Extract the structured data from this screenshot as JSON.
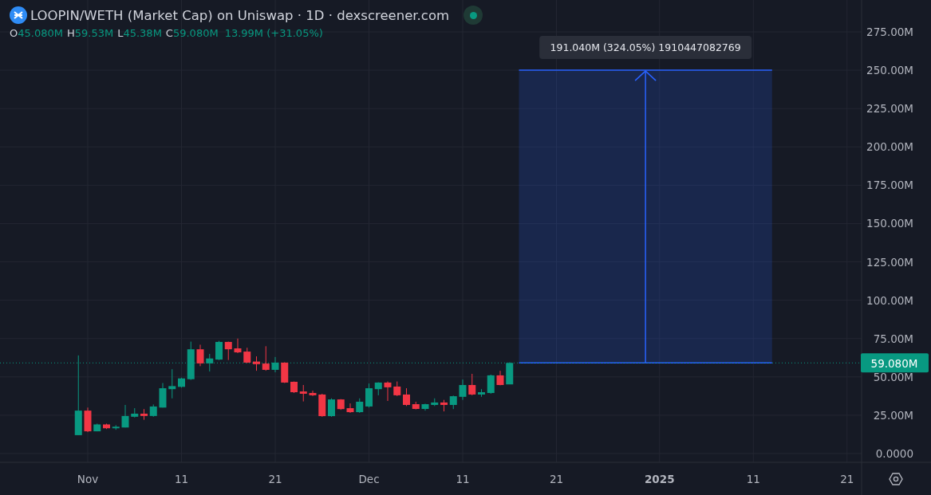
{
  "header": {
    "title": "LOOPIN/WETH (Market Cap) on Uniswap · 1D · dexscreener.com",
    "live": true,
    "legend": [
      {
        "key": "O",
        "value": "45.080M"
      },
      {
        "key": "H",
        "value": "59.53M"
      },
      {
        "key": "L",
        "value": "45.38M"
      },
      {
        "key": "C",
        "value": "59.080M"
      }
    ],
    "change": "13.99M (+31.05%)"
  },
  "chart": {
    "measure_label": "191.040M (324.05%) 1910447082769",
    "last_price_label": "59.080M",
    "price_axis": [
      "275.00M",
      "250.00M",
      "225.00M",
      "200.00M",
      "175.00M",
      "150.00M",
      "125.00M",
      "100.00M",
      "75.00M",
      "50.00M",
      "25.00M",
      "0.0000"
    ],
    "time_axis": [
      {
        "label": "Nov",
        "kind": "date"
      },
      {
        "label": "11",
        "kind": "date"
      },
      {
        "label": "21",
        "kind": "date"
      },
      {
        "label": "Dec",
        "kind": "date"
      },
      {
        "label": "11",
        "kind": "date"
      },
      {
        "label": "21",
        "kind": "date"
      },
      {
        "label": "2025",
        "kind": "year"
      },
      {
        "label": "11",
        "kind": "date"
      },
      {
        "label": "21",
        "kind": "date"
      }
    ]
  }
}
